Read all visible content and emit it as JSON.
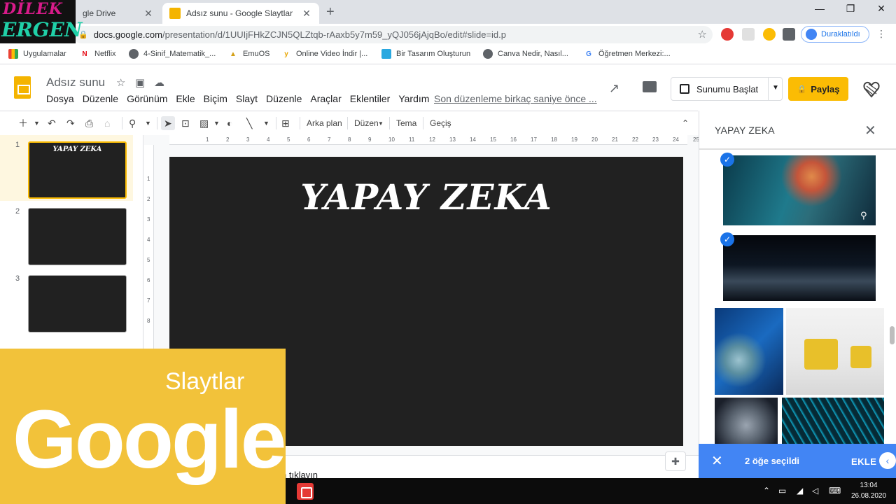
{
  "browser": {
    "tabs": [
      {
        "title": "gle Drive",
        "active": false
      },
      {
        "title": "Adsız sunu - Google Slaytlar",
        "active": true
      }
    ],
    "url_host": "docs.google.com",
    "url_path": "/presentation/d/1UUIjFHkZCJN5QLZtqb-rAaxb5y7m59_yQJ056jAjqBo/edit#slide=id.p",
    "profile_status": "Duraklatıldı",
    "bookmarks": [
      "Uygulamalar",
      "Netflix",
      "4-Sinif_Matematik_...",
      "EmuOS",
      "Online Video İndir |...",
      "Bir Tasarım Oluşturun",
      "Canva Nedir, Nasıl...",
      "Öğretmen Merkezi:..."
    ]
  },
  "overlay_logo": {
    "line1": "DİLEK",
    "line2": "ERGEN"
  },
  "app": {
    "doc_title": "Adsız sunu",
    "menu": [
      "Dosya",
      "Düzenle",
      "Görünüm",
      "Ekle",
      "Biçim",
      "Slayt",
      "Düzenle",
      "Araçlar",
      "Eklentiler",
      "Yardım"
    ],
    "last_edit": "Son düzenleme birkaç saniye önce ...",
    "present_label": "Sunumu Başlat",
    "share_label": "Paylaş"
  },
  "toolbar": {
    "background": "Arka plan",
    "layout": "Düzen",
    "theme": "Tema",
    "transition": "Geçiş"
  },
  "filmstrip": {
    "slides": [
      {
        "number": "1",
        "title": "YAPAY ZEKA"
      },
      {
        "number": "2",
        "title": ""
      },
      {
        "number": "3",
        "title": ""
      }
    ]
  },
  "ruler": {
    "h": [
      "1",
      "2",
      "3",
      "4",
      "5",
      "6",
      "7",
      "8",
      "9",
      "10",
      "11",
      "12",
      "13",
      "14",
      "15",
      "16",
      "17",
      "18",
      "19",
      "20",
      "21",
      "22",
      "23",
      "24",
      "25"
    ],
    "v": [
      "1",
      "2",
      "3",
      "4",
      "5",
      "6",
      "7",
      "8"
    ]
  },
  "slide": {
    "title": "YAPAY ZEKA"
  },
  "notes": {
    "text": "n tıklayın"
  },
  "panel": {
    "title": "YAPAY ZEKA",
    "selected_count": "2 öğe seçildi",
    "add_label": "EKLE"
  },
  "taskbar": {
    "time": "13:04",
    "date": "26.08.2020"
  },
  "promo": {
    "subtitle": "Slaytlar",
    "brand": "Google"
  },
  "colors": {
    "accent": "#fbbc04",
    "panel_blue": "#4285f4",
    "slide_bg": "#212121"
  }
}
